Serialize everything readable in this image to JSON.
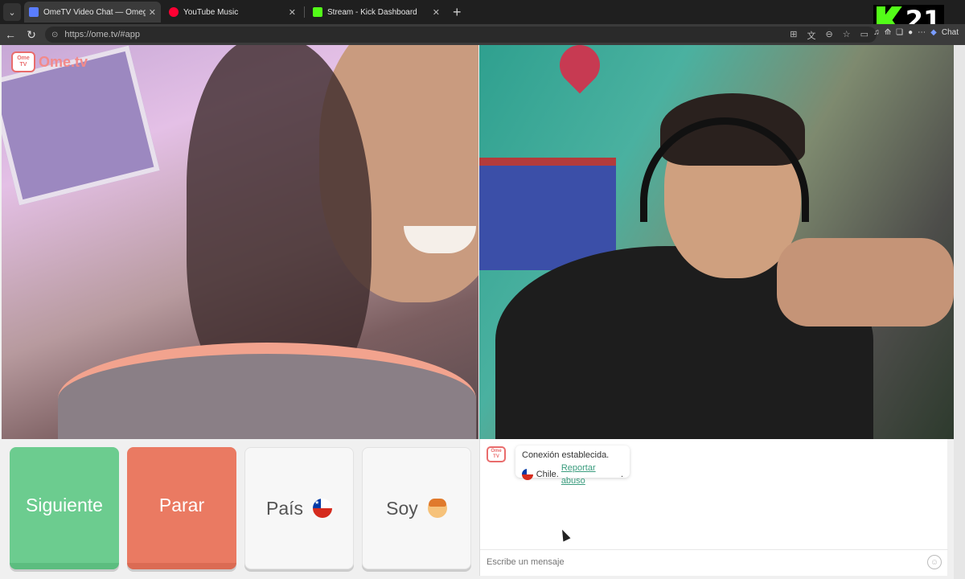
{
  "browser": {
    "tabs": [
      {
        "title": "OmeTV Video Chat — Omegle",
        "favicon_color": "#5a7dff",
        "active": true
      },
      {
        "title": "YouTube Music",
        "favicon_color": "#ff0033",
        "active": false
      },
      {
        "title": "Stream - Kick Dashboard",
        "favicon_color": "#53fc18",
        "active": false
      }
    ],
    "url": "https://ome.tv/#app",
    "ext_label": "Chat"
  },
  "overlay": {
    "number": "21"
  },
  "brand": {
    "logo_top": "Ome",
    "logo_bottom": "TV",
    "logo_text": "Ome.tv",
    "accent": "#e96c6c"
  },
  "controls": {
    "next_label": "Siguiente",
    "stop_label": "Parar",
    "country_label": "País",
    "gender_label": "Soy"
  },
  "chat": {
    "status": "Conexión establecida.",
    "country": "Chile.",
    "report_label": "Reportar abuso",
    "report_suffix": ".",
    "placeholder": "Escribe un mensaje"
  }
}
